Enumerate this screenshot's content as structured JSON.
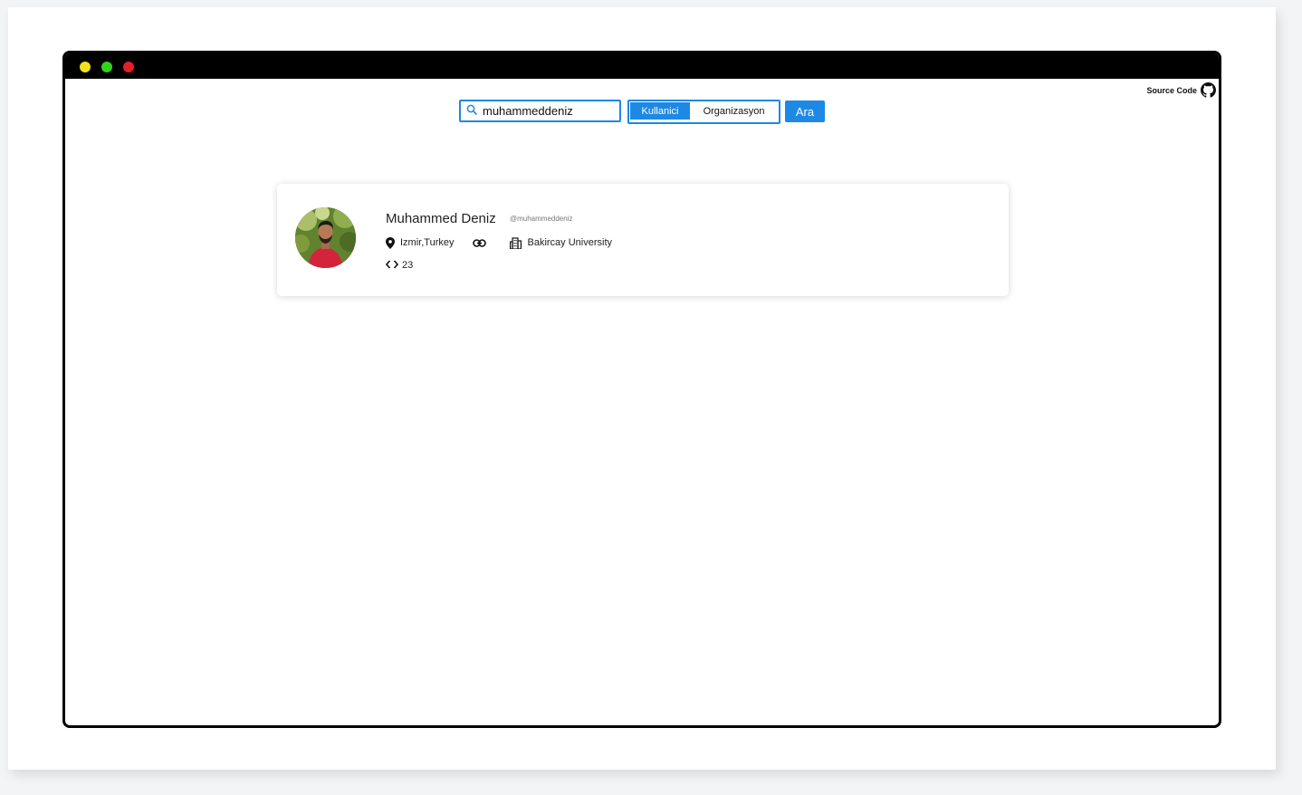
{
  "window": {
    "buttons": [
      "minimize",
      "maximize",
      "close"
    ]
  },
  "header": {
    "source_code_label": "Source Code",
    "source_code_icon": "github-icon"
  },
  "search": {
    "value": "muhammeddeniz",
    "icon": "search-icon",
    "button_label": "Ara"
  },
  "type_toggle": {
    "options": [
      "Kullanici",
      "Organizasyon"
    ],
    "selected": "Kullanici"
  },
  "colors": {
    "accent": "#1e88e5",
    "window_frame": "#000000",
    "dot_yellow": "#f5e11b",
    "dot_green": "#35d11e",
    "dot_red": "#e3202a"
  },
  "profile": {
    "name": "Muhammed Deniz",
    "handle": "@muhammeddeniz",
    "location": "Izmir,Turkey",
    "location_icon": "map-pin-icon",
    "link_icon": "link-icon",
    "company": "Bakircay University",
    "company_icon": "building-icon",
    "repos": "23",
    "repos_icon": "code-icon"
  }
}
